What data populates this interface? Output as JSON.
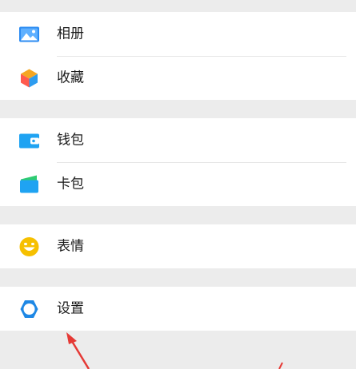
{
  "menu": {
    "groups": [
      {
        "items": [
          {
            "label": "相册",
            "icon": "photo-album-icon",
            "color": "#2b8bf2"
          },
          {
            "label": "收藏",
            "icon": "favorites-cube-icon",
            "color": "#f5a623"
          }
        ]
      },
      {
        "items": [
          {
            "label": "钱包",
            "icon": "wallet-icon",
            "color": "#1fa3f2"
          },
          {
            "label": "卡包",
            "icon": "card-pack-icon",
            "color": "#1fa3f2"
          }
        ]
      },
      {
        "items": [
          {
            "label": "表情",
            "icon": "smiley-icon",
            "color": "#f6c000"
          }
        ]
      },
      {
        "items": [
          {
            "label": "设置",
            "icon": "settings-gear-icon",
            "color": "#1e88e5"
          }
        ]
      }
    ]
  },
  "colors": {
    "background": "#ececec",
    "row": "#ffffff",
    "annotation_arrow": "#e53935"
  }
}
